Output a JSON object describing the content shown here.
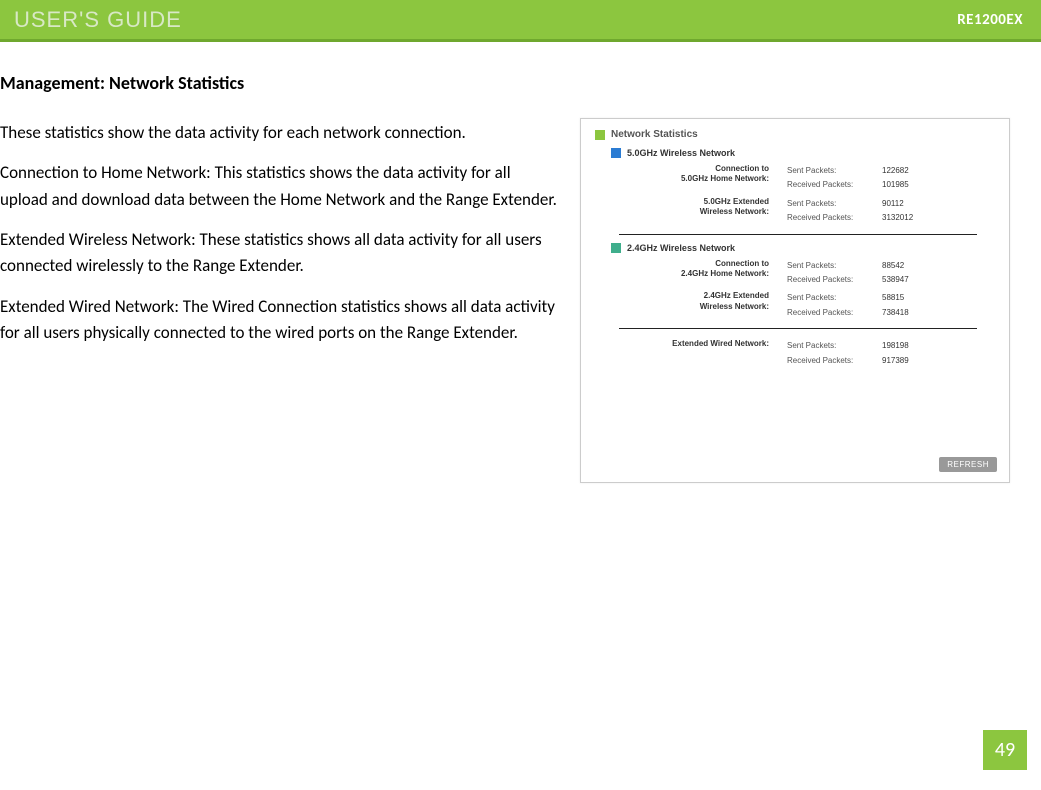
{
  "header": {
    "left": "USER'S GUIDE",
    "right": "RE1200EX"
  },
  "section_title": "Management: Network Statistics",
  "paragraphs": [
    "These statistics show the data activity for each network connection.",
    "Connection to Home Network: This statistics shows the data activity for all upload and download data between the Home Network and the Range Extender.",
    "Extended Wireless Network: These statistics shows all data activity for all users connected wirelessly to the Range Extender.",
    "Extended Wired Network: The Wired Connection statistics shows all data activity for all users physically connected to the wired ports on the Range Extender."
  ],
  "panel": {
    "title": "Network Statistics",
    "group5": {
      "title": "5.0GHz Wireless Network",
      "conn": {
        "label": "Connection to\n5.0GHz Home Network:",
        "sent_label": "Sent Packets:",
        "sent_val": "122682",
        "recv_label": "Received Packets:",
        "recv_val": "101985"
      },
      "ext": {
        "label": "5.0GHz Extended\nWireless Network:",
        "sent_label": "Sent Packets:",
        "sent_val": "90112",
        "recv_label": "Received Packets:",
        "recv_val": "3132012"
      }
    },
    "group24": {
      "title": "2.4GHz Wireless Network",
      "conn": {
        "label": "Connection to\n2.4GHz Home Network:",
        "sent_label": "Sent Packets:",
        "sent_val": "88542",
        "recv_label": "Received Packets:",
        "recv_val": "538947"
      },
      "ext": {
        "label": "2.4GHz Extended\nWireless Network:",
        "sent_label": "Sent Packets:",
        "sent_val": "58815",
        "recv_label": "Received Packets:",
        "recv_val": "738418"
      }
    },
    "wired": {
      "label": "Extended Wired Network:",
      "sent_label": "Sent Packets:",
      "sent_val": "198198",
      "recv_label": "Received Packets:",
      "recv_val": "917389"
    },
    "refresh": "REFRESH"
  },
  "page_number": "49"
}
